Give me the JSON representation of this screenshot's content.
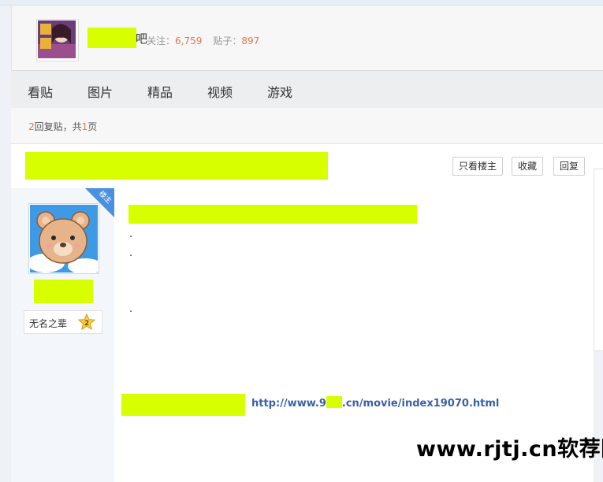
{
  "forum": {
    "name_tail": "吧",
    "stats": {
      "follow_label": "关注：",
      "follow_count": "6,759",
      "posts_label": "贴子：",
      "posts_count": "897"
    }
  },
  "nav": {
    "items": [
      {
        "label": "看贴"
      },
      {
        "label": "图片"
      },
      {
        "label": "精品"
      },
      {
        "label": "视频"
      },
      {
        "label": "游戏"
      }
    ]
  },
  "pager": {
    "reply_count": "2",
    "reply_label": "回复贴，共",
    "page_count": "1",
    "page_label": "页"
  },
  "thread": {
    "buttons": {
      "only_op": "只看楼主",
      "favorite": "收藏",
      "reply": "回复"
    },
    "op_tag": "楼主"
  },
  "author": {
    "level_title": "无名之辈",
    "level": "2"
  },
  "post": {
    "dots": [
      ".",
      ".",
      "."
    ],
    "link_prefix": "http://www.9",
    "link_suffix": ".cn/movie/index19070.html"
  },
  "watermark": {
    "text": "www.rjtj.cn软荐网"
  },
  "colors": {
    "highlight_mask": "#d7ff00",
    "accent_number": "#e9744a",
    "link": "#3a5fa8",
    "op_tag": "#4a8fe0"
  }
}
